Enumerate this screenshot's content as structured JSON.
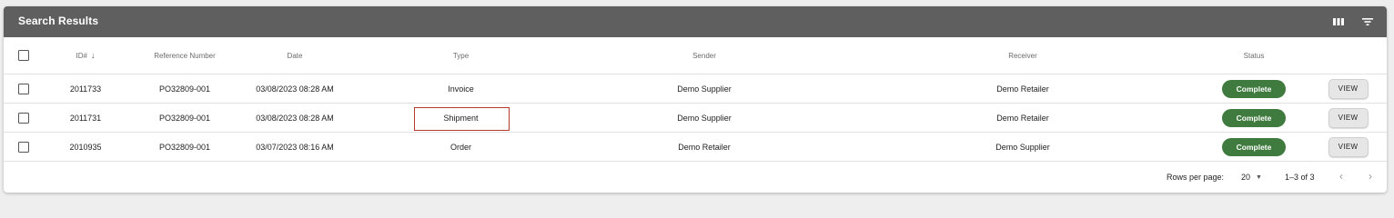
{
  "header": {
    "title": "Search Results",
    "icons": [
      "columns-icon",
      "filter-icon"
    ]
  },
  "table": {
    "columns": {
      "id": "ID#",
      "reference": "Reference Number",
      "date": "Date",
      "type": "Type",
      "sender": "Sender",
      "receiver": "Receiver",
      "status": "Status"
    },
    "rows": [
      {
        "id": "2011733",
        "reference": "PO32809-001",
        "date": "03/08/2023 08:28 AM",
        "type": "Invoice",
        "sender": "Demo Supplier",
        "receiver": "Demo Retailer",
        "status": "Complete",
        "action": "VIEW"
      },
      {
        "id": "2011731",
        "reference": "PO32809-001",
        "date": "03/08/2023 08:28 AM",
        "type": "Shipment",
        "sender": "Demo Supplier",
        "receiver": "Demo Retailer",
        "status": "Complete",
        "action": "VIEW"
      },
      {
        "id": "2010935",
        "reference": "PO32809-001",
        "date": "03/07/2023 08:16 AM",
        "type": "Order",
        "sender": "Demo Retailer",
        "receiver": "Demo Supplier",
        "status": "Complete",
        "action": "VIEW"
      }
    ]
  },
  "pagination": {
    "rows_per_page_label": "Rows per page:",
    "rows_per_page_value": "20",
    "range_label": "1–3 of 3"
  },
  "colors": {
    "header_bg": "#5f5f5f",
    "status_complete": "#3f7a3f",
    "highlight": "#b43a2c"
  }
}
